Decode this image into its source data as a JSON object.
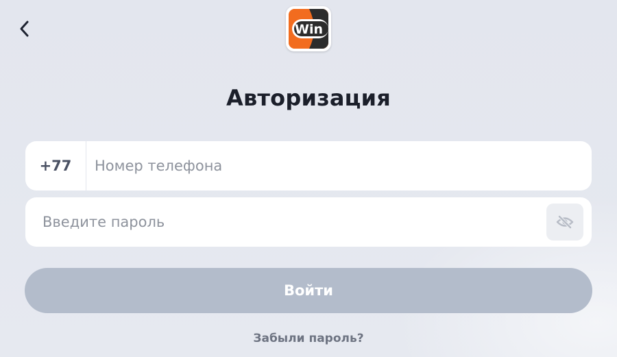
{
  "header": {
    "back_icon": "chevron-left-icon",
    "logo_text": "Win",
    "logo_colors": {
      "orange": "#f26c1f",
      "dark": "#2c2c2c",
      "white": "#ffffff"
    }
  },
  "page": {
    "title": "Авторизация"
  },
  "phone": {
    "prefix": "+77",
    "value": "",
    "placeholder": "Номер телефона"
  },
  "password": {
    "value": "",
    "placeholder": "Введите пароль",
    "toggle_icon": "eye-off-icon"
  },
  "actions": {
    "login_label": "Войти",
    "login_color": "#b3bccb",
    "forgot_label": "Забыли пароль?"
  }
}
